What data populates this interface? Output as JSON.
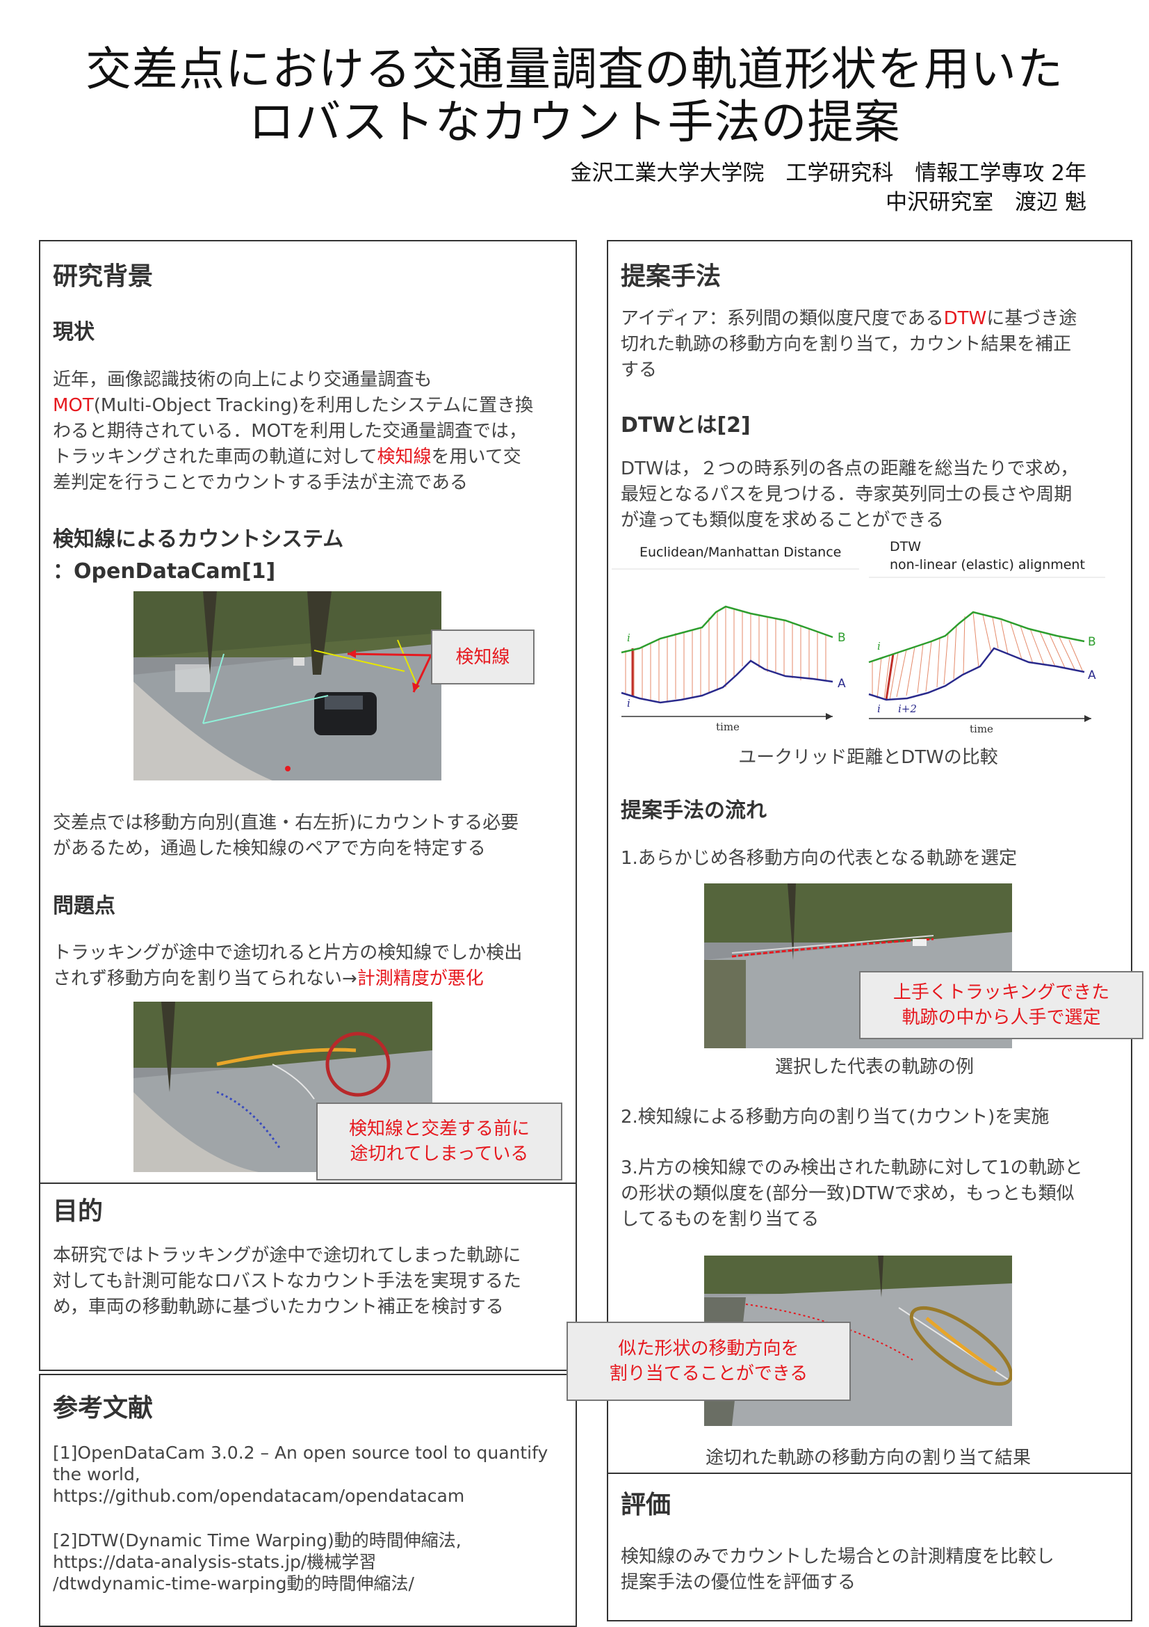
{
  "title": {
    "line1": "交差点における交通量調査の軌道形状を用いた",
    "line2": "ロバストなカウント手法の提案"
  },
  "affiliation": {
    "line1": "金沢工業大学大学院　工学研究科　情報工学専攻 2年",
    "line2": "中沢研究室　渡辺 魁"
  },
  "background": {
    "heading": "研究背景",
    "current_heading": "現状",
    "current_text": {
      "l1": "近年，画像認識技術の向上により交通量調査も",
      "l2_red": "MOT",
      "l2_rest": "(Multi-Object Tracking)を利用したシステムに置き換",
      "l3": "わると期待されている．MOTを利用した交通量調査では，",
      "l4_pre": "トラッキングされた車両の軌道に対して",
      "l4_red": "検知線",
      "l4_post": "を用いて交",
      "l5": "差判定を行うことでカウントする手法が主流である"
    },
    "system_heading_l1": "検知線によるカウントシステム",
    "system_heading_l2": "：OpenDataCam[1]",
    "callout_detect": "検知線",
    "system_text_l1": "交差点では移動方向別(直進・右左折)にカウントする必要",
    "system_text_l2": "があるため，通過した検知線のペアで方向を特定する",
    "problem_heading": "問題点",
    "problem_text_l1": "トラッキングが途中で途切れると片方の検知線でしか検出",
    "problem_text_l2_pre": "されず移動方向を割り当てられない→",
    "problem_text_l2_red": "計測精度が悪化",
    "callout_break_l1": "検知線と交差する前に",
    "callout_break_l2": "途切れてしまっている"
  },
  "purpose": {
    "heading": "目的",
    "l1": "本研究ではトラッキングが途中で途切れてしまった軌跡に",
    "l2": "対しても計測可能なロバストなカウント手法を実現するた",
    "l3": "め，車両の移動軌跡に基づいたカウント補正を検討する"
  },
  "references": {
    "heading": "参考文献",
    "r1_l1": "[1]OpenDataCam 3.0.2 – An open source tool to quantify",
    "r1_l2": "the world,",
    "r1_l3": "https://github.com/opendatacam/opendatacam",
    "r2_l1": "[2]DTW(Dynamic Time Warping)動的時間伸縮法,",
    "r2_l2": "https://data-analysis-stats.jp/機械学習",
    "r2_l3": "/dtwdynamic-time-warping動的時間伸縮法/"
  },
  "method": {
    "heading": "提案手法",
    "idea_l1_pre": "アイディア：系列間の類似度尺度である",
    "idea_l1_red": "DTW",
    "idea_l1_post": "に基づき途",
    "idea_l2": "切れた軌跡の移動方向を割り当て，カウント結果を補正",
    "idea_l3": "する",
    "dtw_heading": "DTWとは[2]",
    "dtw_l1": "DTWは，２つの時系列の各点の距離を総当たりで求め，",
    "dtw_l2": "最短となるパスを見つける．寺家英列同士の長さや周期",
    "dtw_l3": "が違っても類似度を求めることができる",
    "fig_left_title": "Euclidean/Manhattan Distance",
    "fig_right_title_l1": "DTW",
    "fig_right_title_l2": "non-linear (elastic) alignment",
    "fig_label_b": "B",
    "fig_label_a": "A",
    "fig_label_i": "i",
    "fig_label_i2": "i+2",
    "fig_label_time": "time",
    "fig_caption": "ユークリッド距離とDTWの比較",
    "flow_heading": "提案手法の流れ",
    "step1": "1.あらかじめ各移動方向の代表となる軌跡を選定",
    "callout_select_l1": "上手くトラッキングできた",
    "callout_select_l2": "軌跡の中から人手で選定",
    "photo2_caption": "選択した代表の軌跡の例",
    "step2": "2.検知線による移動方向の割り当て(カウント)を実施",
    "step3_l1": "3.片方の検知線でのみ検出された軌跡に対して1の軌跡と",
    "step3_l2": "の形状の類似度を(部分一致)DTWで求め，もっとも類似",
    "step3_l3": "してるものを割り当てる",
    "callout_assign_l1": "似た形状の移動方向を",
    "callout_assign_l2": "割り当てることができる",
    "photo3_caption": "途切れた軌跡の移動方向の割り当て結果"
  },
  "evaluation": {
    "heading": "評価",
    "l1": "検知線のみでカウントした場合との計測精度を比較し",
    "l2": "提案手法の優位性を評価する"
  },
  "colors": {
    "accent_red": "#e6191f",
    "series_b": "#2e9e2e",
    "series_a": "#2a2a8c",
    "callout_bg": "#ececec"
  }
}
